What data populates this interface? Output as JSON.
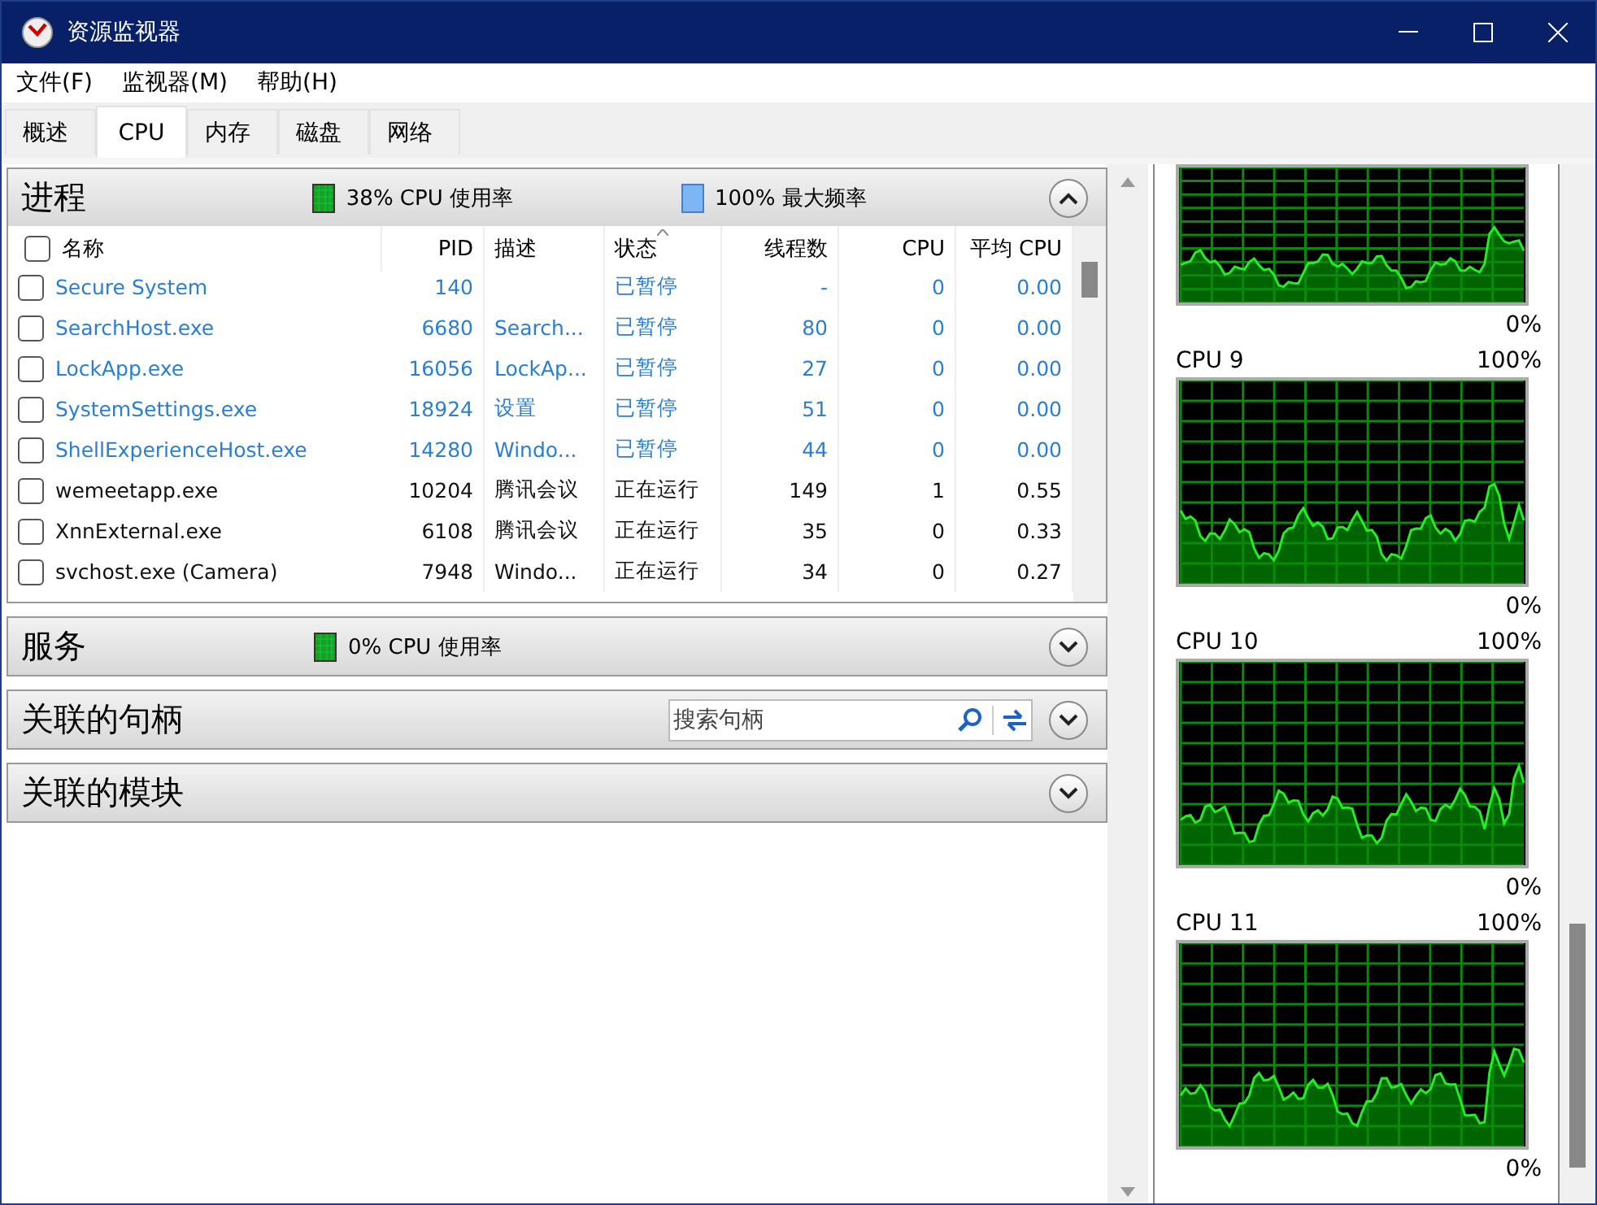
{
  "window": {
    "title": "资源监视器"
  },
  "menu": [
    "文件(F)",
    "监视器(M)",
    "帮助(H)"
  ],
  "tabs": [
    {
      "label": "概述",
      "selected": false
    },
    {
      "label": "CPU",
      "selected": true
    },
    {
      "label": "内存",
      "selected": false
    },
    {
      "label": "磁盘",
      "selected": false
    },
    {
      "label": "网络",
      "selected": false
    }
  ],
  "processes": {
    "title": "进程",
    "expanded": true,
    "stats": [
      {
        "kind": "usage",
        "text": "38% CPU 使用率"
      },
      {
        "kind": "frequency",
        "text": "100% 最大频率"
      }
    ],
    "all_checked": false,
    "columns": [
      "名称",
      "PID",
      "描述",
      "状态",
      "线程数",
      "CPU",
      "平均 CPU"
    ],
    "rows": [
      {
        "checked": false,
        "suspended": true,
        "cells": [
          "Secure System",
          "140",
          "",
          "已暂停",
          "-",
          "0",
          "0.00"
        ]
      },
      {
        "checked": false,
        "suspended": true,
        "cells": [
          "SearchHost.exe",
          "6680",
          "Search...",
          "已暂停",
          "80",
          "0",
          "0.00"
        ]
      },
      {
        "checked": false,
        "suspended": true,
        "cells": [
          "LockApp.exe",
          "16056",
          "LockAp...",
          "已暂停",
          "27",
          "0",
          "0.00"
        ]
      },
      {
        "checked": false,
        "suspended": true,
        "cells": [
          "SystemSettings.exe",
          "18924",
          "设置",
          "已暂停",
          "51",
          "0",
          "0.00"
        ]
      },
      {
        "checked": false,
        "suspended": true,
        "cells": [
          "ShellExperienceHost.exe",
          "14280",
          "Windo...",
          "已暂停",
          "44",
          "0",
          "0.00"
        ]
      },
      {
        "checked": false,
        "suspended": false,
        "cells": [
          "wemeetapp.exe",
          "10204",
          "腾讯会议",
          "正在运行",
          "149",
          "1",
          "0.55"
        ]
      },
      {
        "checked": false,
        "suspended": false,
        "cells": [
          "XnnExternal.exe",
          "6108",
          "腾讯会议",
          "正在运行",
          "35",
          "0",
          "0.33"
        ]
      },
      {
        "checked": false,
        "suspended": false,
        "cells": [
          "svchost.exe (Camera)",
          "7948",
          "Windo...",
          "正在运行",
          "34",
          "0",
          "0.27"
        ]
      }
    ]
  },
  "sections": [
    {
      "title": "服务",
      "expanded": false,
      "stats": [
        {
          "kind": "usage",
          "text": "0% CPU 使用率"
        }
      ]
    },
    {
      "title": "关联的句柄",
      "expanded": false,
      "search": {
        "placeholder": "搜索句柄"
      }
    },
    {
      "title": "关联的模块",
      "expanded": false
    }
  ],
  "graphs": [
    {
      "min": "0%"
    },
    {
      "title": "CPU 9",
      "max": "100%",
      "min": "0%"
    },
    {
      "title": "CPU 10",
      "max": "100%",
      "min": "0%"
    },
    {
      "title": "CPU 11",
      "max": "100%",
      "min": "0%"
    }
  ]
}
